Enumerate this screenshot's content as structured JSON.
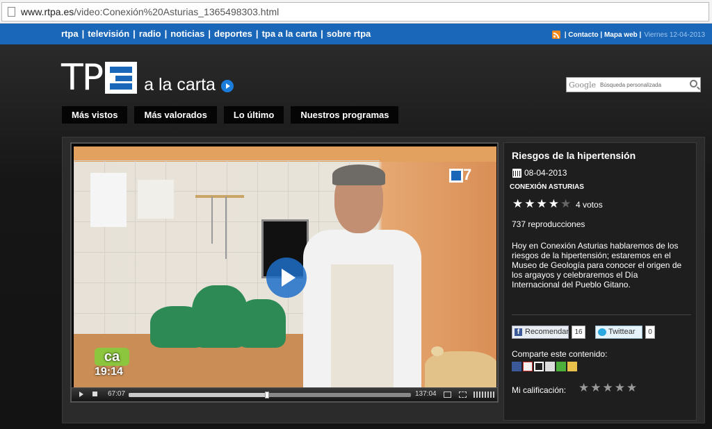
{
  "browser": {
    "url_host": "www.rtpa.es",
    "url_path": "/video:Conexión%20Asturias_1365498303.html"
  },
  "topnav": {
    "links": [
      "rtpa",
      "televisión",
      "radio",
      "noticias",
      "deportes",
      "tpa a la carta",
      "sobre rtpa"
    ],
    "contacto": "Contacto",
    "mapa": "Mapa web",
    "date": "Viernes 12-04-2013"
  },
  "logo": {
    "tp": "TP",
    "sub": "a la carta"
  },
  "search": {
    "google": "Google",
    "placeholder": "Búsqueda personalizada"
  },
  "tabs": [
    "Más vistos",
    "Más valorados",
    "Lo último",
    "Nuestros programas"
  ],
  "player": {
    "elapsed": "67:07",
    "total": "137:04",
    "progress_fraction": 0.49,
    "overlay_channel": "a7",
    "overlay_logo": "ca",
    "overlay_time": "19:14"
  },
  "video_info": {
    "title": "Riesgos de la hipertensión",
    "date": "08-04-2013",
    "program": "CONEXIÓN ASTURIAS",
    "rating": 4,
    "rating_max": 5,
    "votes": "4 votos",
    "plays": "737 reproducciones",
    "description": "Hoy en Conexión Asturias hablaremos de los riesgos de la hipertensión; estaremos en el Museo de Geología para conocer el origen de los argayos y celebraremos el Día Internacional del Pueblo Gitano.",
    "facebook_label": "Recomendar",
    "facebook_count": "16",
    "twitter_label": "Twittear",
    "twitter_count": "0",
    "share_label": "Comparte este contenido:",
    "my_rating_label": "Mi calificación:"
  },
  "colors": {
    "brand_blue": "#1a66b8",
    "background": "#1b1b1b"
  }
}
